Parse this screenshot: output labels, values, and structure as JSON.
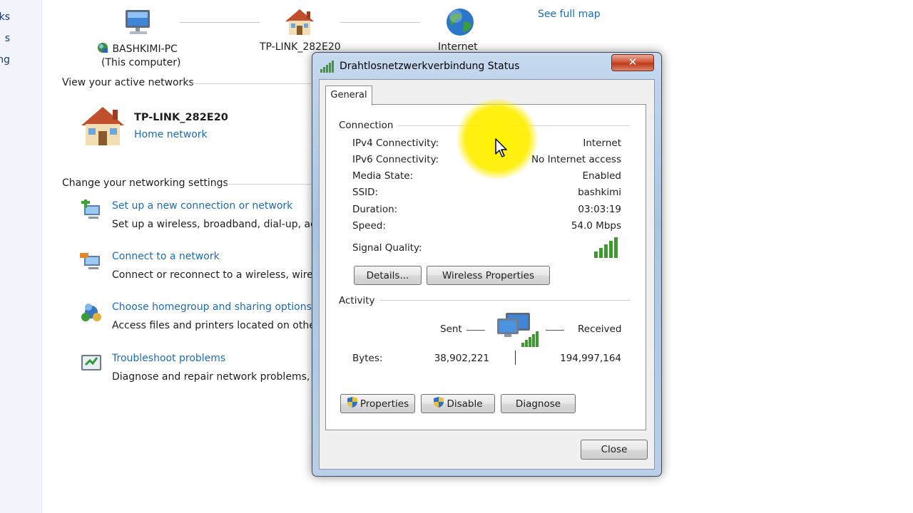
{
  "left_nav": {
    "items": [
      "ks",
      "s",
      "ng"
    ]
  },
  "network_map": {
    "computer_name": "BASHKIMI-PC",
    "computer_sub": "(This computer)",
    "router_name": "TP-LINK_282E20",
    "internet_label": "Internet",
    "see_full_map": "See full map"
  },
  "active_networks": {
    "heading": "View your active networks",
    "network_name": "TP-LINK_282E20",
    "network_type": "Home network"
  },
  "settings": {
    "heading": "Change your networking settings",
    "items": [
      {
        "title": "Set up a new connection or network",
        "desc": "Set up a wireless, broadband, dial-up, ad"
      },
      {
        "title": "Connect to a network",
        "desc": "Connect or reconnect to a wireless, wired"
      },
      {
        "title": "Choose homegroup and sharing options",
        "desc": "Access files and printers located on other"
      },
      {
        "title": "Troubleshoot problems",
        "desc": "Diagnose and repair network problems, o"
      }
    ]
  },
  "dialog": {
    "title": "Drahtlosnetzwerkverbindung Status",
    "close_glyph": "✕",
    "tab": "General",
    "connection": {
      "heading": "Connection",
      "rows": [
        {
          "label": "IPv4 Connectivity:",
          "value": "Internet"
        },
        {
          "label": "IPv6 Connectivity:",
          "value": "No Internet access"
        },
        {
          "label": "Media State:",
          "value": "Enabled"
        },
        {
          "label": "SSID:",
          "value": "bashkimi"
        },
        {
          "label": "Duration:",
          "value": "03:03:19"
        },
        {
          "label": "Speed:",
          "value": "54.0 Mbps"
        }
      ],
      "signal_label": "Signal Quality:",
      "signal_bars": 5
    },
    "buttons": {
      "details": "Details...",
      "wireless_properties": "Wireless Properties",
      "properties": "Properties",
      "disable": "Disable",
      "diagnose": "Diagnose",
      "close": "Close"
    },
    "activity": {
      "heading": "Activity",
      "sent_label": "Sent",
      "received_label": "Received",
      "bytes_label": "Bytes:",
      "bytes_sent": "38,902,221",
      "bytes_received": "194,997,164"
    }
  },
  "colors": {
    "link": "#1e6bb8",
    "highlight": "#fff200",
    "signal": "#3c9a2e"
  }
}
